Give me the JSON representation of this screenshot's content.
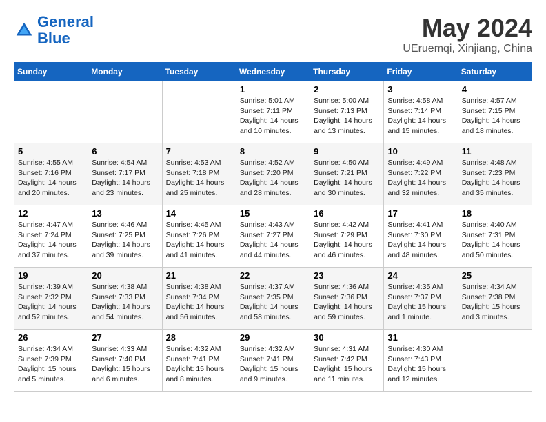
{
  "header": {
    "logo_line1": "General",
    "logo_line2": "Blue",
    "title": "May 2024",
    "subtitle": "UEruemqi, Xinjiang, China"
  },
  "weekdays": [
    "Sunday",
    "Monday",
    "Tuesday",
    "Wednesday",
    "Thursday",
    "Friday",
    "Saturday"
  ],
  "weeks": [
    [
      {
        "day": "",
        "text": ""
      },
      {
        "day": "",
        "text": ""
      },
      {
        "day": "",
        "text": ""
      },
      {
        "day": "1",
        "text": "Sunrise: 5:01 AM\nSunset: 7:11 PM\nDaylight: 14 hours\nand 10 minutes."
      },
      {
        "day": "2",
        "text": "Sunrise: 5:00 AM\nSunset: 7:13 PM\nDaylight: 14 hours\nand 13 minutes."
      },
      {
        "day": "3",
        "text": "Sunrise: 4:58 AM\nSunset: 7:14 PM\nDaylight: 14 hours\nand 15 minutes."
      },
      {
        "day": "4",
        "text": "Sunrise: 4:57 AM\nSunset: 7:15 PM\nDaylight: 14 hours\nand 18 minutes."
      }
    ],
    [
      {
        "day": "5",
        "text": "Sunrise: 4:55 AM\nSunset: 7:16 PM\nDaylight: 14 hours\nand 20 minutes."
      },
      {
        "day": "6",
        "text": "Sunrise: 4:54 AM\nSunset: 7:17 PM\nDaylight: 14 hours\nand 23 minutes."
      },
      {
        "day": "7",
        "text": "Sunrise: 4:53 AM\nSunset: 7:18 PM\nDaylight: 14 hours\nand 25 minutes."
      },
      {
        "day": "8",
        "text": "Sunrise: 4:52 AM\nSunset: 7:20 PM\nDaylight: 14 hours\nand 28 minutes."
      },
      {
        "day": "9",
        "text": "Sunrise: 4:50 AM\nSunset: 7:21 PM\nDaylight: 14 hours\nand 30 minutes."
      },
      {
        "day": "10",
        "text": "Sunrise: 4:49 AM\nSunset: 7:22 PM\nDaylight: 14 hours\nand 32 minutes."
      },
      {
        "day": "11",
        "text": "Sunrise: 4:48 AM\nSunset: 7:23 PM\nDaylight: 14 hours\nand 35 minutes."
      }
    ],
    [
      {
        "day": "12",
        "text": "Sunrise: 4:47 AM\nSunset: 7:24 PM\nDaylight: 14 hours\nand 37 minutes."
      },
      {
        "day": "13",
        "text": "Sunrise: 4:46 AM\nSunset: 7:25 PM\nDaylight: 14 hours\nand 39 minutes."
      },
      {
        "day": "14",
        "text": "Sunrise: 4:45 AM\nSunset: 7:26 PM\nDaylight: 14 hours\nand 41 minutes."
      },
      {
        "day": "15",
        "text": "Sunrise: 4:43 AM\nSunset: 7:27 PM\nDaylight: 14 hours\nand 44 minutes."
      },
      {
        "day": "16",
        "text": "Sunrise: 4:42 AM\nSunset: 7:29 PM\nDaylight: 14 hours\nand 46 minutes."
      },
      {
        "day": "17",
        "text": "Sunrise: 4:41 AM\nSunset: 7:30 PM\nDaylight: 14 hours\nand 48 minutes."
      },
      {
        "day": "18",
        "text": "Sunrise: 4:40 AM\nSunset: 7:31 PM\nDaylight: 14 hours\nand 50 minutes."
      }
    ],
    [
      {
        "day": "19",
        "text": "Sunrise: 4:39 AM\nSunset: 7:32 PM\nDaylight: 14 hours\nand 52 minutes."
      },
      {
        "day": "20",
        "text": "Sunrise: 4:38 AM\nSunset: 7:33 PM\nDaylight: 14 hours\nand 54 minutes."
      },
      {
        "day": "21",
        "text": "Sunrise: 4:38 AM\nSunset: 7:34 PM\nDaylight: 14 hours\nand 56 minutes."
      },
      {
        "day": "22",
        "text": "Sunrise: 4:37 AM\nSunset: 7:35 PM\nDaylight: 14 hours\nand 58 minutes."
      },
      {
        "day": "23",
        "text": "Sunrise: 4:36 AM\nSunset: 7:36 PM\nDaylight: 14 hours\nand 59 minutes."
      },
      {
        "day": "24",
        "text": "Sunrise: 4:35 AM\nSunset: 7:37 PM\nDaylight: 15 hours\nand 1 minute."
      },
      {
        "day": "25",
        "text": "Sunrise: 4:34 AM\nSunset: 7:38 PM\nDaylight: 15 hours\nand 3 minutes."
      }
    ],
    [
      {
        "day": "26",
        "text": "Sunrise: 4:34 AM\nSunset: 7:39 PM\nDaylight: 15 hours\nand 5 minutes."
      },
      {
        "day": "27",
        "text": "Sunrise: 4:33 AM\nSunset: 7:40 PM\nDaylight: 15 hours\nand 6 minutes."
      },
      {
        "day": "28",
        "text": "Sunrise: 4:32 AM\nSunset: 7:41 PM\nDaylight: 15 hours\nand 8 minutes."
      },
      {
        "day": "29",
        "text": "Sunrise: 4:32 AM\nSunset: 7:41 PM\nDaylight: 15 hours\nand 9 minutes."
      },
      {
        "day": "30",
        "text": "Sunrise: 4:31 AM\nSunset: 7:42 PM\nDaylight: 15 hours\nand 11 minutes."
      },
      {
        "day": "31",
        "text": "Sunrise: 4:30 AM\nSunset: 7:43 PM\nDaylight: 15 hours\nand 12 minutes."
      },
      {
        "day": "",
        "text": ""
      }
    ]
  ]
}
